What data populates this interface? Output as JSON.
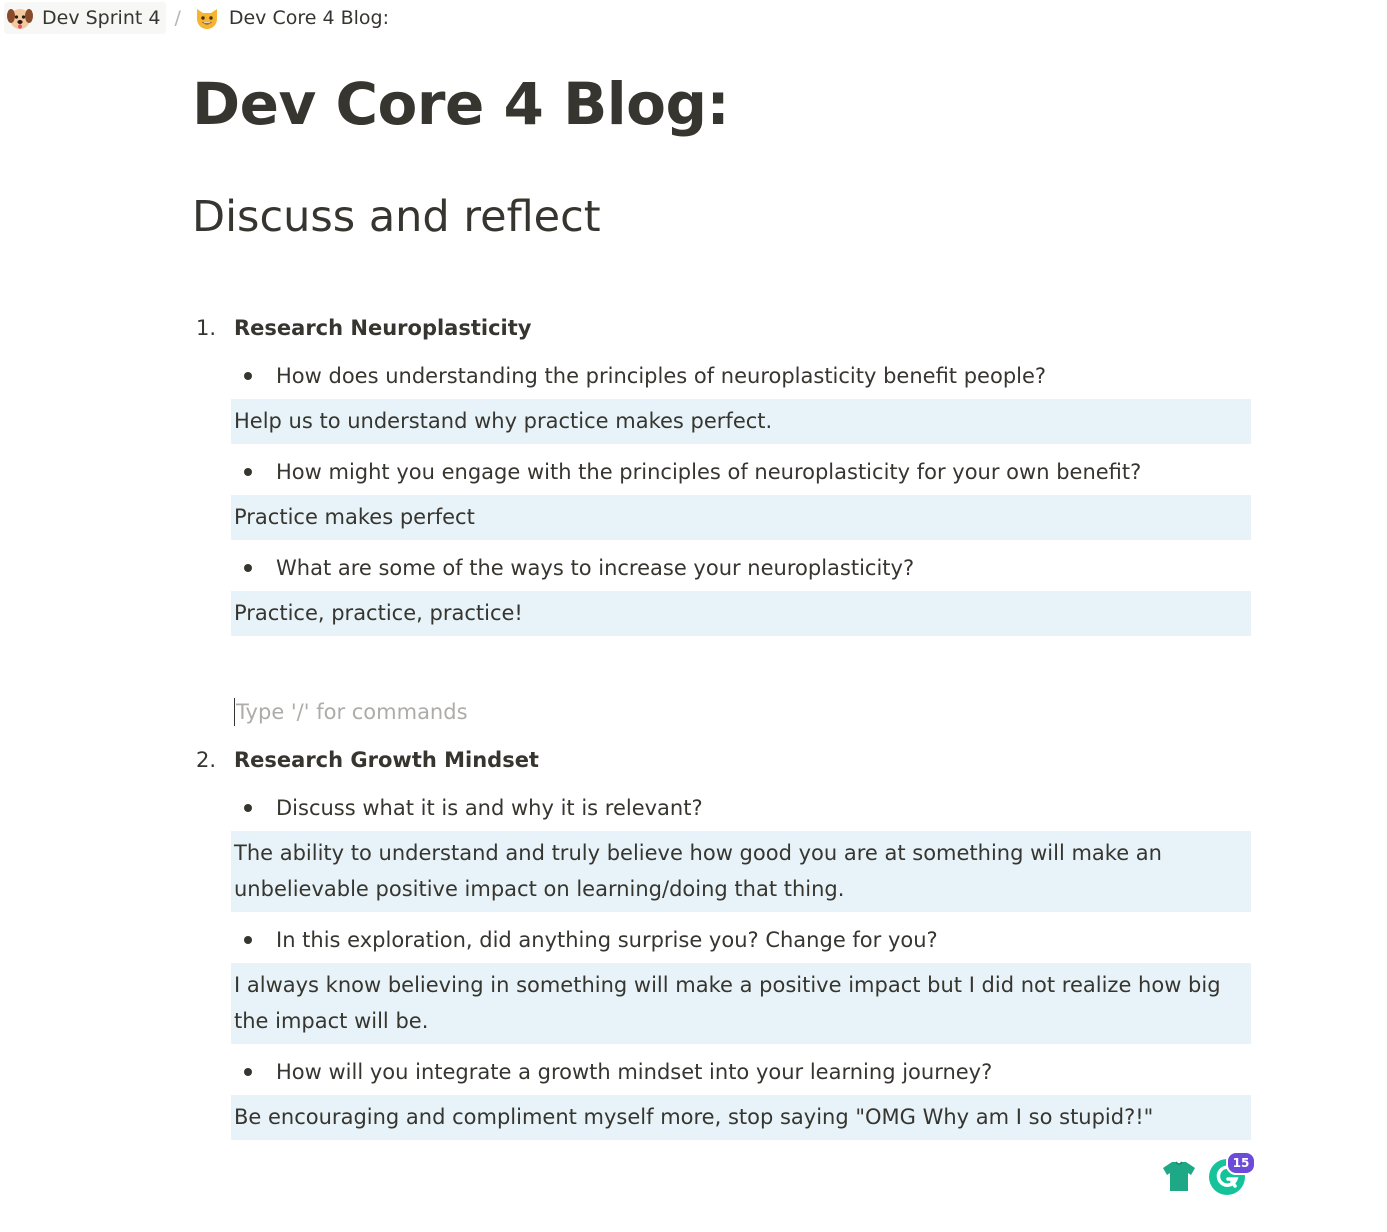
{
  "breadcrumb": {
    "items": [
      {
        "label": "Dev Sprint 4",
        "icon": "dog-face-icon"
      },
      {
        "label": "Dev Core 4 Blog:",
        "icon": "cat-face-icon"
      }
    ],
    "separator": "/"
  },
  "page": {
    "title": "Dev Core 4 Blog:",
    "heading": "Discuss and reflect"
  },
  "sections": [
    {
      "number": "1.",
      "title": "Research Neuroplasticity",
      "qa": [
        {
          "question": "How does understanding the principles of neuroplasticity benefit people?",
          "answer": "Help us to understand why practice makes perfect."
        },
        {
          "question": "How might you engage with the principles of neuroplasticity for your own benefit?",
          "answer": "Practice makes perfect"
        },
        {
          "question": "What are some of the ways to increase your neuroplasticity?",
          "answer": "Practice, practice, practice!"
        }
      ]
    },
    {
      "number": "2.",
      "title": "Research Growth Mindset",
      "qa": [
        {
          "question": "Discuss what it is and why it is relevant?",
          "answer": "The ability to understand and truly believe how good you are at something will make an unbelievable positive impact on learning/doing that thing."
        },
        {
          "question": "In this exploration, did anything surprise you? Change for you?",
          "answer": "I always know believing in something will make a positive impact but I did not realize how big the impact will be."
        },
        {
          "question": "How will you integrate a growth mindset into your learning journey?",
          "answer": "Be encouraging and compliment myself more, stop saying \"OMG Why am I so stupid?!\""
        }
      ]
    }
  ],
  "editor": {
    "placeholder": "Type '/' for commands"
  },
  "extensions": {
    "shirt_icon": "tshirt-icon",
    "grammarly_icon": "grammarly-icon",
    "grammarly_badge": "15",
    "accent_green": "#15c39a",
    "shirt_green": "#1fa886",
    "badge_purple": "#6c4bd8"
  },
  "colors": {
    "text": "#37352f",
    "answer_bg": "#e7f3f8",
    "placeholder": "#aeaca8"
  }
}
